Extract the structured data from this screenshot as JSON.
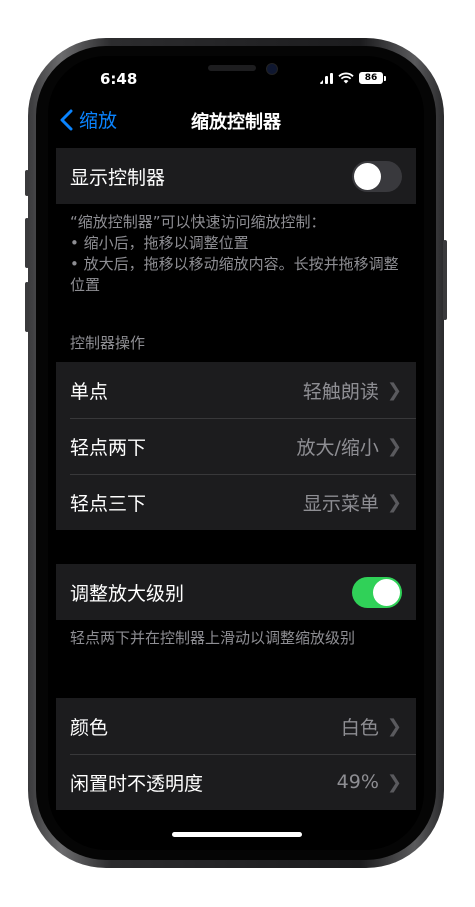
{
  "status_bar": {
    "time": "6:48",
    "battery": "86"
  },
  "nav": {
    "back_label": "缩放",
    "title": "缩放控制器"
  },
  "show_controller": {
    "label": "显示控制器",
    "enabled": false
  },
  "description": {
    "line1": "“缩放控制器”可以快速访问缩放控制：",
    "line2": "• 缩小后，拖移以调整位置",
    "line3": "• 放大后，拖移以移动缩放内容。长按并拖移调整位置"
  },
  "actions_header": "控制器操作",
  "actions": [
    {
      "label": "单点",
      "value": "轻触朗读"
    },
    {
      "label": "轻点两下",
      "value": "放大/缩小"
    },
    {
      "label": "轻点三下",
      "value": "显示菜单"
    }
  ],
  "adjust_zoom": {
    "label": "调整放大级别",
    "enabled": true,
    "footer": "轻点两下并在控制器上滑动以调整缩放级别"
  },
  "appearance": [
    {
      "label": "颜色",
      "value": "白色"
    },
    {
      "label": "闲置时不透明度",
      "value": "49%"
    }
  ],
  "colors": {
    "accent": "#0a84ff",
    "toggle_on": "#30d158",
    "background": "#000000",
    "cell": "#1c1c1e"
  },
  "icons": {
    "back": "chevron-left-icon",
    "disclosure": "chevron-right-icon",
    "wifi": "wifi-icon",
    "signal": "cellular-signal-icon",
    "battery": "battery-icon"
  }
}
